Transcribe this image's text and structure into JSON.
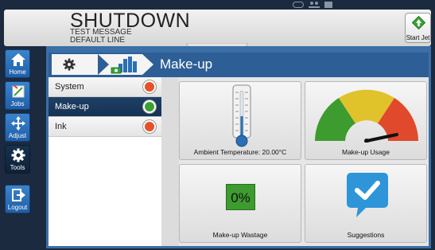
{
  "header": {
    "state": "SHUTDOWN",
    "message": "TEST MESSAGE",
    "line": "DEFAULT LINE",
    "start_label": "Start Jet"
  },
  "sidebar": {
    "items": [
      {
        "label": "Home",
        "icon": "home-icon",
        "active": false
      },
      {
        "label": "Jobs",
        "icon": "jobs-icon",
        "active": false
      },
      {
        "label": "Adjust",
        "icon": "adjust-icon",
        "active": false
      },
      {
        "label": "Tools",
        "icon": "gear-icon",
        "active": true
      },
      {
        "label": "Logout",
        "icon": "logout-icon",
        "active": false
      }
    ]
  },
  "breadcrumb": {
    "title": "Make-up"
  },
  "list": {
    "items": [
      {
        "label": "System",
        "status_color": "#e8502a",
        "selected": false
      },
      {
        "label": "Make-up",
        "status_color": "#3aa234",
        "selected": true
      },
      {
        "label": "Ink",
        "status_color": "#e8502a",
        "selected": false
      }
    ]
  },
  "tiles": {
    "temperature": {
      "caption": "Ambient Temperature: 20.00°C",
      "value_c": 20.0
    },
    "usage": {
      "caption": "Make-up Usage",
      "gauge_colors": [
        "#3e9b2f",
        "#e0c32a",
        "#e0492b"
      ]
    },
    "wastage": {
      "caption": "Make-up Wastage",
      "value": "0%"
    },
    "suggestions": {
      "caption": "Suggestions"
    }
  },
  "colors": {
    "accent_blue": "#2d5f96",
    "nav_blue": "#2a6fb8",
    "start_green": "#3aa234"
  }
}
